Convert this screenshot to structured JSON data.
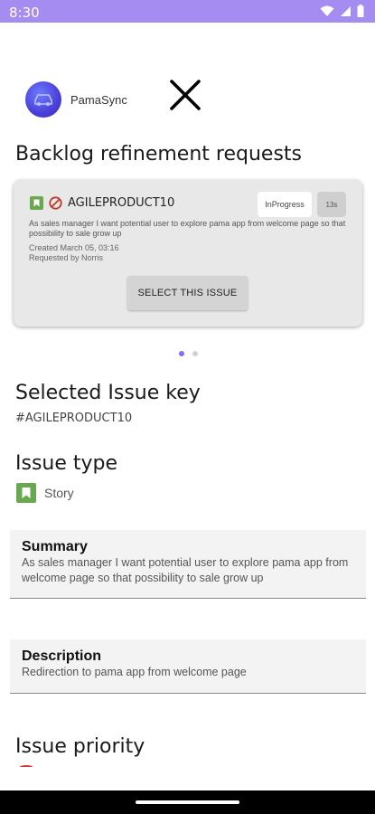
{
  "status_bar": {
    "time": "8:30"
  },
  "app": {
    "name": "PamaSync"
  },
  "backlog": {
    "title": "Backlog refinement requests",
    "card": {
      "key": "AGILEPRODUCT10",
      "status": "InProgress",
      "story_points": "13s",
      "description": "As sales manager I want potential user to explore pama app from welcome page so that possibility to sale grow up",
      "created": "Created March 05, 03:16",
      "requested_by": "Requested by Norris",
      "select_label": "SELECT THIS ISSUE"
    },
    "pagination": {
      "pages": 2,
      "active": 1
    }
  },
  "selected_issue": {
    "title": "Selected Issue key",
    "value": "#AGILEPRODUCT10"
  },
  "issue_type": {
    "title": "Issue type",
    "value": "Story",
    "icon": "story-bookmark-icon",
    "color": "#6aa84f"
  },
  "summary": {
    "title": "Summary",
    "text": "As sales manager I want potential user to explore pama app from welcome page so that possibility to sale grow up"
  },
  "description": {
    "title": "Description",
    "text": "Redirection to pama app from welcome page"
  },
  "issue_priority": {
    "title": "Issue priority"
  },
  "colors": {
    "status_bar": "#a58cf0",
    "accent": "#8b6cf0",
    "story_green": "#6aa84f",
    "blocked_red": "#c0392b"
  }
}
